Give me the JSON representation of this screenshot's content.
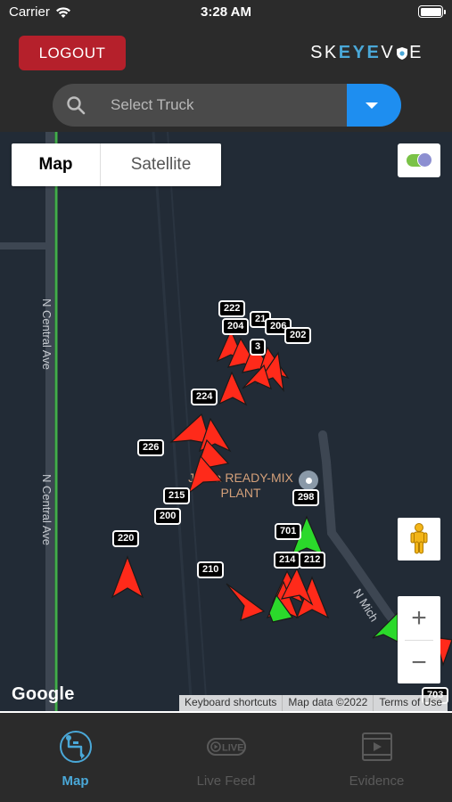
{
  "status_bar": {
    "carrier": "Carrier",
    "time": "3:28 AM",
    "wifi_icon": "wifi-icon",
    "battery_icon": "battery-icon"
  },
  "header": {
    "logout_label": "LOGOUT",
    "brand": {
      "part1": "SK",
      "part2": "EYE",
      "part3": "V",
      "part4": "E",
      "accent_color": "#4aa8d8"
    }
  },
  "truck_select": {
    "placeholder": "Select Truck",
    "search_icon": "search-icon",
    "dropdown_icon": "chevron-down-icon",
    "accent_color": "#1e8ef0"
  },
  "map": {
    "map_type_options": [
      "Map",
      "Satellite"
    ],
    "selected_map_type": "Map",
    "road_labels": [
      "N Central Ave",
      "N Central Ave",
      "N Mich"
    ],
    "poi": {
      "line1": "Jarica READY-MIX",
      "line2": "PLANT"
    },
    "google_logo": "Google",
    "attribution": [
      "Keyboard shortcuts",
      "Map data ©2022",
      "Terms of Use"
    ],
    "zoom_in": "+",
    "zoom_out": "−",
    "truck_labels": [
      "222",
      "204",
      "21",
      "206",
      "202",
      "3",
      "224",
      "226",
      "215",
      "200",
      "220",
      "298",
      "701",
      "214",
      "212",
      "210",
      "703"
    ],
    "marker_colors": {
      "red": "#ff2a1a",
      "green": "#2bd92b"
    }
  },
  "tabs": [
    {
      "label": "Map",
      "icon": "map-route-icon",
      "active": true
    },
    {
      "label": "Live Feed",
      "icon": "live-feed-icon",
      "active": false
    },
    {
      "label": "Evidence",
      "icon": "video-evidence-icon",
      "active": false
    }
  ]
}
